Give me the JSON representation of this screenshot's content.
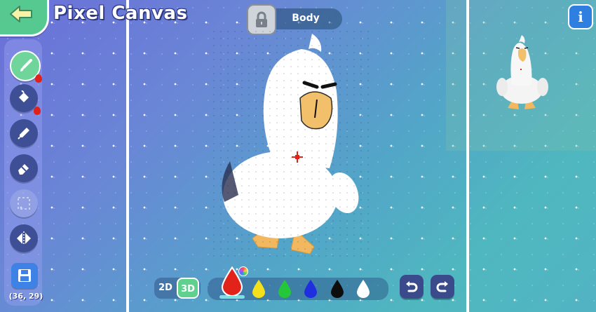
{
  "app": {
    "title": "Pixel Canvas"
  },
  "header": {
    "back_icon": "arrow-left-icon",
    "layer": {
      "name": "Body",
      "lock_icon": "lock-icon"
    },
    "info_label": "i"
  },
  "toolbar": {
    "tools": [
      {
        "name": "brush",
        "icon": "brush-icon",
        "active": true,
        "badge": "red-drop"
      },
      {
        "name": "fill",
        "icon": "paint-bucket-icon",
        "active": false,
        "badge": "red-drop"
      },
      {
        "name": "eyedropper",
        "icon": "eyedropper-icon",
        "active": false
      },
      {
        "name": "eraser",
        "icon": "eraser-icon",
        "active": false
      },
      {
        "name": "select",
        "icon": "selection-icon",
        "active": false,
        "disabled": true
      },
      {
        "name": "mirror",
        "icon": "mirror-icon",
        "active": false
      }
    ],
    "save_icon": "save-icon",
    "coordinates": "(36, 29)"
  },
  "bottom": {
    "mode": {
      "label_2d": "2D",
      "label_3d": "3D",
      "selected": "3D"
    },
    "palette": [
      {
        "color": "#e2231a",
        "selected": true
      },
      {
        "color": "#f5e11b",
        "selected": false
      },
      {
        "color": "#24c63a",
        "selected": false
      },
      {
        "color": "#1f2fe0",
        "selected": false
      },
      {
        "color": "#0d0d0d",
        "selected": false
      },
      {
        "color": "#ffffff",
        "selected": false
      }
    ],
    "undo_icon": "undo-icon",
    "redo_icon": "redo-icon"
  },
  "colors": {
    "accent_green": "#5fd08e",
    "toolbar_button": "#3e4f96",
    "info_blue": "#2f7fe0",
    "beak_orange": "#f2b860"
  }
}
